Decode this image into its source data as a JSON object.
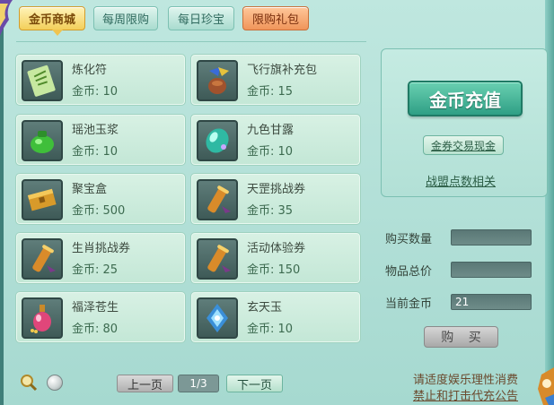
{
  "tabs": [
    {
      "label": "金币商城",
      "active": true
    },
    {
      "label": "每周限购",
      "active": false
    },
    {
      "label": "每日珍宝",
      "active": false
    },
    {
      "label": "限购礼包",
      "active": false
    }
  ],
  "items": [
    {
      "name": "炼化符",
      "price": "金币: 10",
      "icon": "talisman-icon"
    },
    {
      "name": "飞行旗补充包",
      "price": "金币: 15",
      "icon": "flag-pack-icon"
    },
    {
      "name": "瑶池玉浆",
      "price": "金币: 10",
      "icon": "jade-jar-icon"
    },
    {
      "name": "九色甘露",
      "price": "金币: 10",
      "icon": "dew-gem-icon"
    },
    {
      "name": "聚宝盒",
      "price": "金币: 500",
      "icon": "treasure-box-icon"
    },
    {
      "name": "天罡挑战券",
      "price": "金币: 35",
      "icon": "scroll-icon"
    },
    {
      "name": "生肖挑战券",
      "price": "金币: 25",
      "icon": "scroll-icon"
    },
    {
      "name": "活动体验券",
      "price": "金币: 150",
      "icon": "scroll-icon"
    },
    {
      "name": "福泽苍生",
      "price": "金币: 80",
      "icon": "potion-bottle-icon"
    },
    {
      "name": "玄天玉",
      "price": "金币: 10",
      "icon": "xuan-jade-icon"
    }
  ],
  "panel": {
    "recharge_label": "金币充值",
    "exchange_label": "金券交易现金",
    "alliance_label": "战盟点数相关"
  },
  "purchase": {
    "qty_label": "购买数量",
    "qty_value": "",
    "total_label": "物品总价",
    "total_value": "",
    "gold_label": "当前金币",
    "gold_value": "21",
    "buy_label": "购 买"
  },
  "pager": {
    "prev_label": "上一页",
    "page": "1/3",
    "next_label": "下一页"
  },
  "notices": {
    "line1": "请适度娱乐理性消费",
    "line2": "禁止和打击代充公告"
  },
  "colors": {
    "accent_gold": "#f3cf5a",
    "accent_green": "#2f9f85",
    "panel_bg": "#bfe7df"
  }
}
